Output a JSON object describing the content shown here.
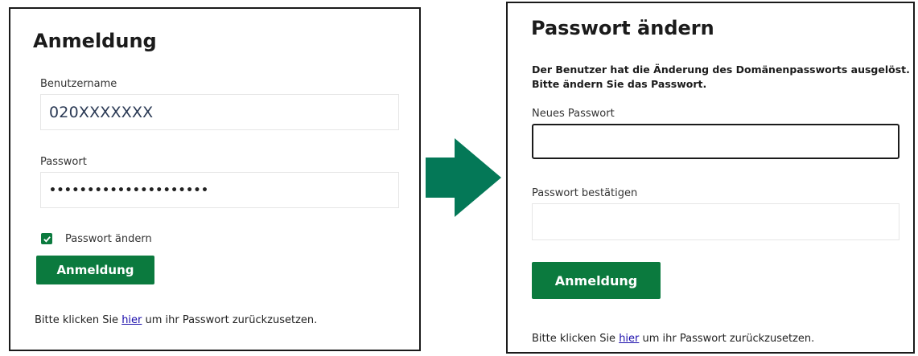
{
  "login": {
    "title": "Anmeldung",
    "username_label": "Benutzername",
    "username_value": "020XXXXXXX",
    "password_label": "Passwort",
    "password_value": "•••••••••••••••••••••",
    "change_password_checkbox_label": "Passwort ändern",
    "change_password_checked": true,
    "submit_label": "Anmeldung",
    "footer_prefix": "Bitte klicken Sie ",
    "footer_link": "hier",
    "footer_suffix": " um ihr Passwort zurückzusetzen."
  },
  "change_password": {
    "title": "Passwort ändern",
    "message_line1": "Der Benutzer hat die Änderung des Domänenpassworts ausgelöst.",
    "message_line2": "Bitte ändern Sie das Passwort.",
    "new_password_label": "Neues Passwort",
    "new_password_value": "",
    "confirm_password_label": "Passwort bestätigen",
    "confirm_password_value": "",
    "submit_label": "Anmeldung",
    "footer_prefix": "Bitte klicken Sie ",
    "footer_link": "hier",
    "footer_suffix": " um ihr Passwort zurückzusetzen."
  },
  "colors": {
    "accent": "#0b7a3e",
    "arrow": "#047857",
    "link": "#1a0dab",
    "border": "#1a1a1a"
  },
  "icons": {
    "transition": "right-arrow-icon",
    "checkbox": "checkmark-icon"
  }
}
